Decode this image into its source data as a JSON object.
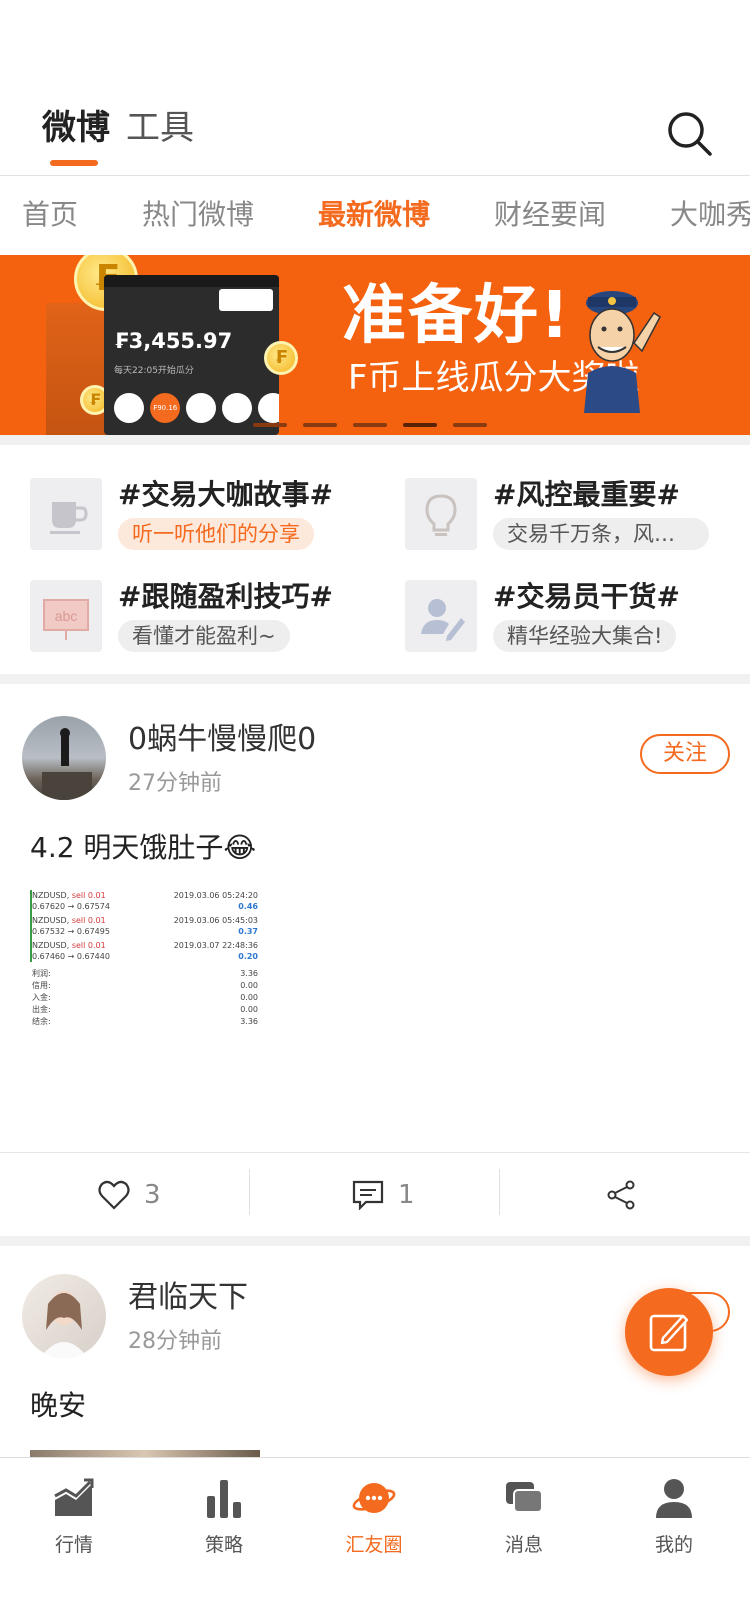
{
  "header": {
    "tabs": [
      {
        "label": "微博",
        "active": true
      },
      {
        "label": "工具",
        "active": false
      }
    ],
    "search_icon": "search-icon"
  },
  "subnav": {
    "items": [
      {
        "label": "首页",
        "active": false
      },
      {
        "label": "热门微博",
        "active": false
      },
      {
        "label": "最新微博",
        "active": true
      },
      {
        "label": "财经要闻",
        "active": false
      },
      {
        "label": "大咖秀",
        "active": false
      }
    ]
  },
  "banner": {
    "title": "准备好!",
    "subtitle": "F币上线瓜分大奖啦",
    "phone_amount": "₣3,455.97",
    "phone_note": "每天22:05开始瓜分",
    "phone_chip": "₣90.16",
    "coin_symbol": "₣",
    "slide_count": 5,
    "active_slide": 4,
    "accent": "#f5620f"
  },
  "topics": [
    {
      "name": "#交易大咖故事#",
      "desc": "听一听他们的分享",
      "icon": "cup-icon",
      "highlight": true
    },
    {
      "name": "#风控最重要#",
      "desc": "交易千万条，风…",
      "icon": "lightbulb-icon",
      "highlight": false
    },
    {
      "name": "#跟随盈利技巧#",
      "desc": "看懂才能盈利~",
      "icon": "whiteboard-icon",
      "highlight": false
    },
    {
      "name": "#交易员干货#",
      "desc": "精华经验大集合!",
      "icon": "user-edit-icon",
      "highlight": false
    }
  ],
  "posts": [
    {
      "user": "0蜗牛慢慢爬0",
      "time": "27分钟前",
      "follow_label": "关注",
      "text": "4.2  明天饿肚子😂",
      "likes": "3",
      "comments": "1",
      "screenshot": {
        "trades": [
          {
            "pair": "NZDUSD,",
            "side": "sell 0.01",
            "date": "2019.03.06 05:24:20",
            "prices": "0.67620 → 0.67574",
            "profit": "0.46"
          },
          {
            "pair": "NZDUSD,",
            "side": "sell 0.01",
            "date": "2019.03.06 05:45:03",
            "prices": "0.67532 → 0.67495",
            "profit": "0.37"
          },
          {
            "pair": "NZDUSD,",
            "side": "sell 0.01",
            "date": "2019.03.07 22:48:36",
            "prices": "0.67460 → 0.67440",
            "profit": "0.20"
          }
        ],
        "summary": [
          {
            "label": "利润:",
            "value": "3.36"
          },
          {
            "label": "信用:",
            "value": "0.00"
          },
          {
            "label": "入金:",
            "value": "0.00"
          },
          {
            "label": "出金:",
            "value": "0.00"
          },
          {
            "label": "结余:",
            "value": "3.36"
          }
        ]
      }
    },
    {
      "user": "君临天下",
      "time": "28分钟前",
      "text": "晚安"
    }
  ],
  "fab_icon": "compose-icon",
  "tabbar": {
    "items": [
      {
        "label": "行情",
        "icon": "market-chart-icon",
        "active": false
      },
      {
        "label": "策略",
        "icon": "bar-chart-icon",
        "active": false
      },
      {
        "label": "汇友圈",
        "icon": "planet-chat-icon",
        "active": true
      },
      {
        "label": "消息",
        "icon": "messages-icon",
        "active": false
      },
      {
        "label": "我的",
        "icon": "user-icon",
        "active": false
      }
    ],
    "active_color": "#f46a1e"
  }
}
